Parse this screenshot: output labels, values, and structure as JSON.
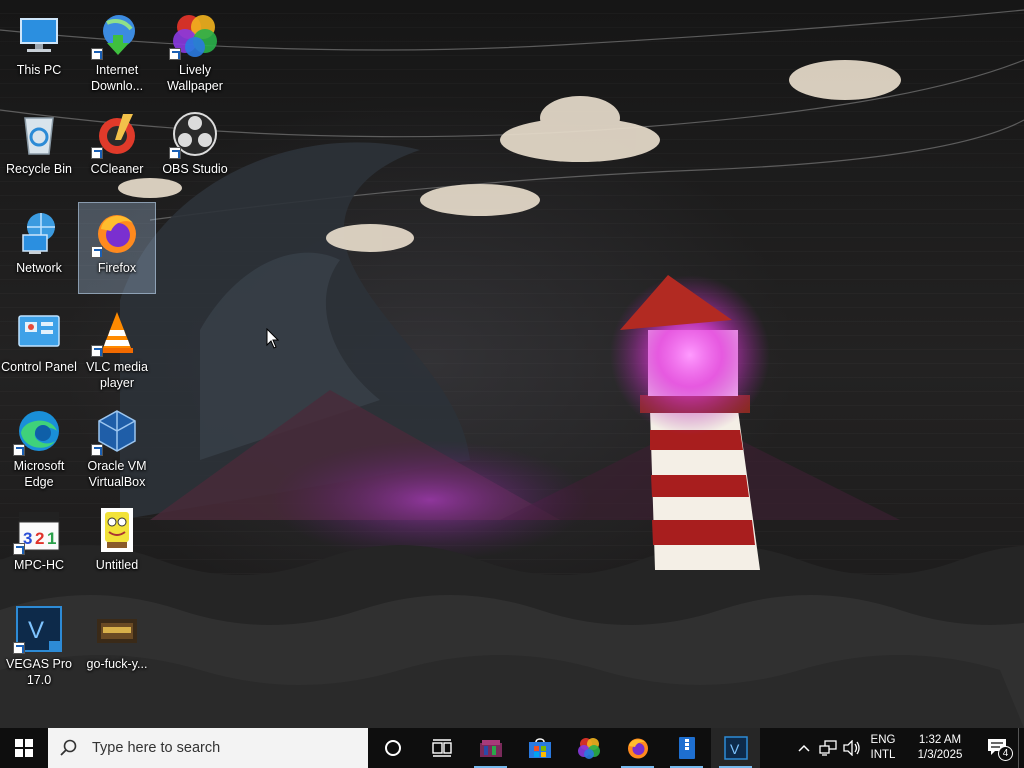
{
  "desktop": {
    "icons": [
      {
        "label": "This PC",
        "icon": "computer-icon"
      },
      {
        "label": "Internet Downlo...",
        "icon": "internet-download-manager-icon"
      },
      {
        "label": "Lively Wallpaper",
        "icon": "lively-wallpaper-icon"
      },
      {
        "label": "Recycle Bin",
        "icon": "recycle-bin-icon"
      },
      {
        "label": "CCleaner",
        "icon": "ccleaner-icon"
      },
      {
        "label": "OBS Studio",
        "icon": "obs-studio-icon"
      },
      {
        "label": "Network",
        "icon": "network-icon"
      },
      {
        "label": "Firefox",
        "icon": "firefox-icon"
      },
      {
        "label": "Control Panel",
        "icon": "control-panel-icon"
      },
      {
        "label": "VLC media player",
        "icon": "vlc-icon"
      },
      {
        "label": "Microsoft Edge",
        "icon": "edge-icon"
      },
      {
        "label": "Oracle VM VirtualBox",
        "icon": "virtualbox-icon"
      },
      {
        "label": "MPC-HC",
        "icon": "mpc-hc-icon"
      },
      {
        "label": "Untitled",
        "icon": "spongebob-image-icon"
      },
      {
        "label": "VEGAS Pro 17.0",
        "icon": "vegas-pro-icon"
      },
      {
        "label": "go-fuck-y...",
        "icon": "image-file-icon"
      }
    ],
    "selected_icon": "Firefox"
  },
  "taskbar": {
    "search_placeholder": "Type here to search",
    "pinned": [
      {
        "name": "cortana-icon"
      },
      {
        "name": "task-view-icon"
      },
      {
        "name": "winrar-icon"
      },
      {
        "name": "microsoft-store-icon"
      },
      {
        "name": "lively-wallpaper-icon"
      },
      {
        "name": "firefox-icon"
      },
      {
        "name": "archive-app-icon"
      },
      {
        "name": "vegas-pro-icon"
      }
    ],
    "tray": {
      "language_top": "ENG",
      "language_bottom": "INTL",
      "time": "1:32 AM",
      "date": "1/3/2025",
      "notification_count": "4"
    }
  },
  "colors": {
    "taskbar_bg": "#0e0e0e",
    "accent": "#76b9ed",
    "selection": "#aac8e6"
  }
}
